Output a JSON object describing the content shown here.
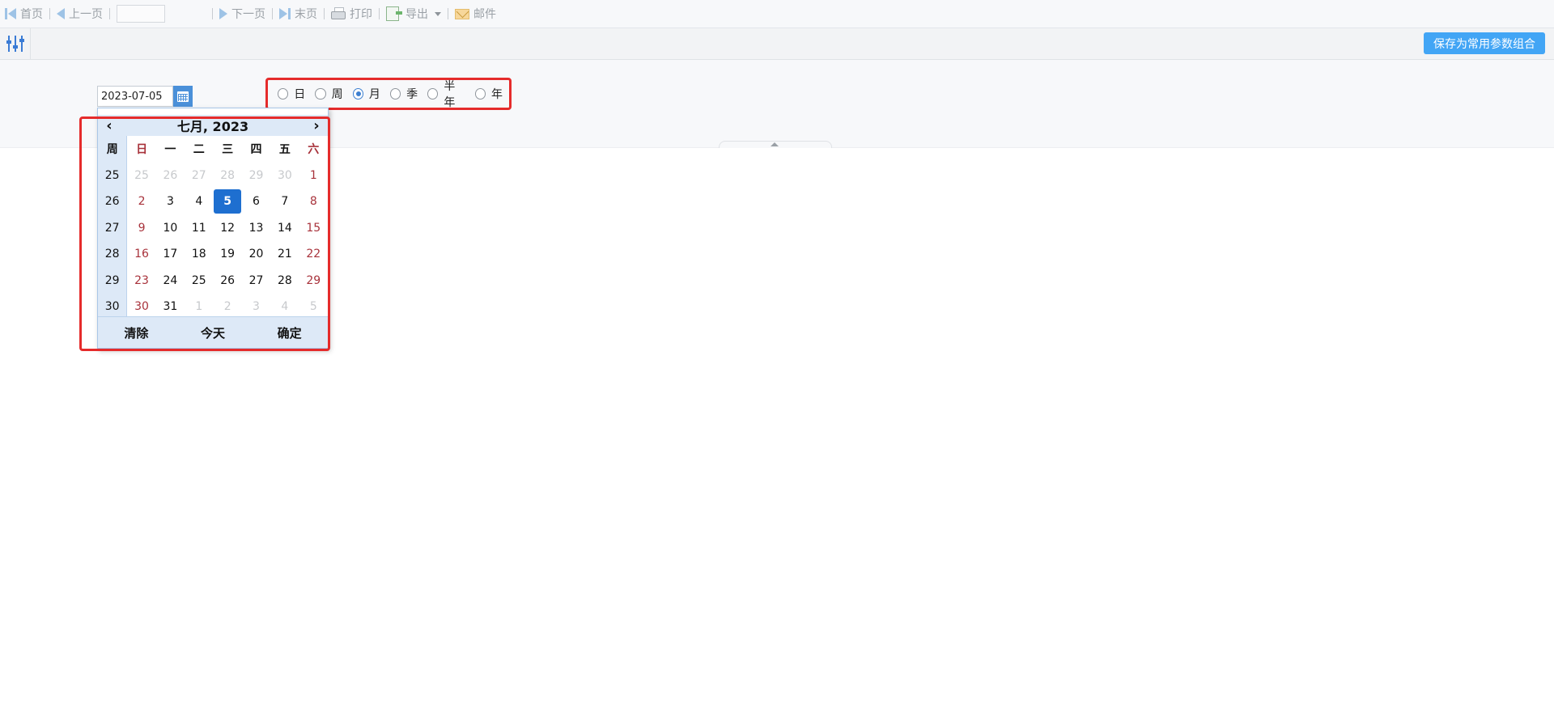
{
  "toolbar": {
    "first": "首页",
    "prev": "上一页",
    "next": "下一页",
    "last": "末页",
    "print": "打印",
    "export": "导出",
    "mail": "邮件"
  },
  "param_bar": {
    "save_combo": "保存为常用参数组合"
  },
  "date_field": {
    "value": "2023-07-05"
  },
  "period": {
    "selected": "月",
    "options": [
      "日",
      "周",
      "月",
      "季",
      "半年",
      "年"
    ]
  },
  "calendar": {
    "title": "七月, 2023",
    "prev": "‹",
    "next": "›",
    "week_header": "周",
    "weekdays": [
      "日",
      "一",
      "二",
      "三",
      "四",
      "五",
      "六"
    ],
    "weeks": [
      {
        "week": "25",
        "days": [
          "25",
          "26",
          "27",
          "28",
          "29",
          "30",
          "1"
        ]
      },
      {
        "week": "26",
        "days": [
          "2",
          "3",
          "4",
          "5",
          "6",
          "7",
          "8"
        ]
      },
      {
        "week": "27",
        "days": [
          "9",
          "10",
          "11",
          "12",
          "13",
          "14",
          "15"
        ]
      },
      {
        "week": "28",
        "days": [
          "16",
          "17",
          "18",
          "19",
          "20",
          "21",
          "22"
        ]
      },
      {
        "week": "29",
        "days": [
          "23",
          "24",
          "25",
          "26",
          "27",
          "28",
          "29"
        ]
      },
      {
        "week": "30",
        "days": [
          "30",
          "31",
          "1",
          "2",
          "3",
          "4",
          "5"
        ]
      }
    ],
    "selected_day": "5",
    "clear": "清除",
    "today": "今天",
    "confirm": "确定"
  },
  "colors": {
    "accent": "#42a5f5",
    "selected_day": "#1e6fd0",
    "weekend": "#a8323b",
    "highlight_outline": "#e52b2b"
  }
}
